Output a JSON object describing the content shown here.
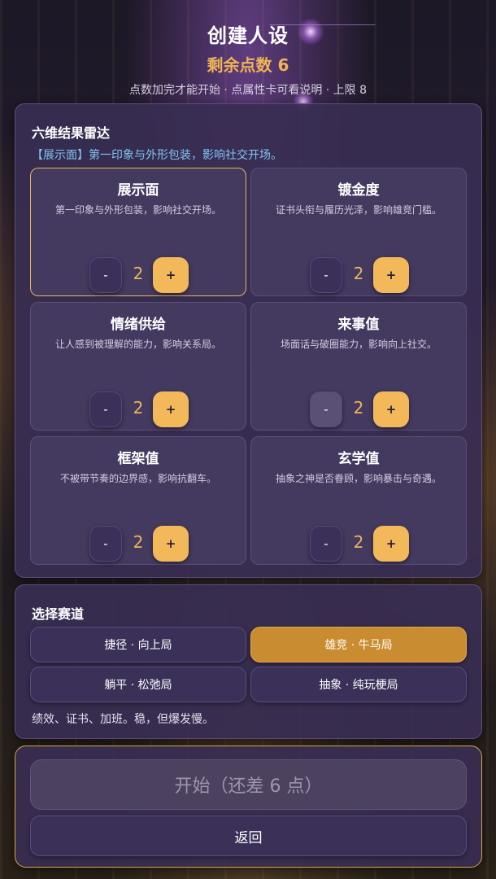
{
  "header": {
    "title": "创建人设",
    "remaining_points": "剩余点数 6",
    "hint": "点数加完才能开始 · 点属性卡可看说明 · 上限 8"
  },
  "attributes_panel": {
    "title": "六维结果雷达",
    "selected_description": "【展示面】第一印象与外形包装，影响社交开场。",
    "cards": [
      {
        "name": "展示面",
        "desc": "第一印象与外形包装，影响社交开场。",
        "value": "2",
        "minus": "-",
        "plus": "+"
      },
      {
        "name": "镀金度",
        "desc": "证书头衔与履历光泽，影响雄竞门槛。",
        "value": "2",
        "minus": "-",
        "plus": "+"
      },
      {
        "name": "情绪供给",
        "desc": "让人感到被理解的能力，影响关系局。",
        "value": "2",
        "minus": "-",
        "plus": "+"
      },
      {
        "name": "来事值",
        "desc": "场面话与破圈能力，影响向上社交。",
        "value": "2",
        "minus": "-",
        "plus": "+"
      },
      {
        "name": "框架值",
        "desc": "不被带节奏的边界感，影响抗翻车。",
        "value": "2",
        "minus": "-",
        "plus": "+"
      },
      {
        "name": "玄学值",
        "desc": "抽象之神是否眷顾，影响暴击与奇遇。",
        "value": "2",
        "minus": "-",
        "plus": "+"
      }
    ]
  },
  "track_panel": {
    "title": "选择赛道",
    "options": [
      {
        "label": "捷径 · 向上局"
      },
      {
        "label": "雄竞 · 牛马局"
      },
      {
        "label": "躺平 · 松弛局"
      },
      {
        "label": "抽象 · 纯玩梗局"
      }
    ],
    "selected_index": 1,
    "description": "绩效、证书、加班。稳，但爆发慢。"
  },
  "actions": {
    "start_label": "开始（还差 6 点）",
    "back_label": "返回"
  },
  "colors": {
    "accent": "#f2b85a",
    "panel": "#382e52",
    "info": "#7fc4f2"
  }
}
